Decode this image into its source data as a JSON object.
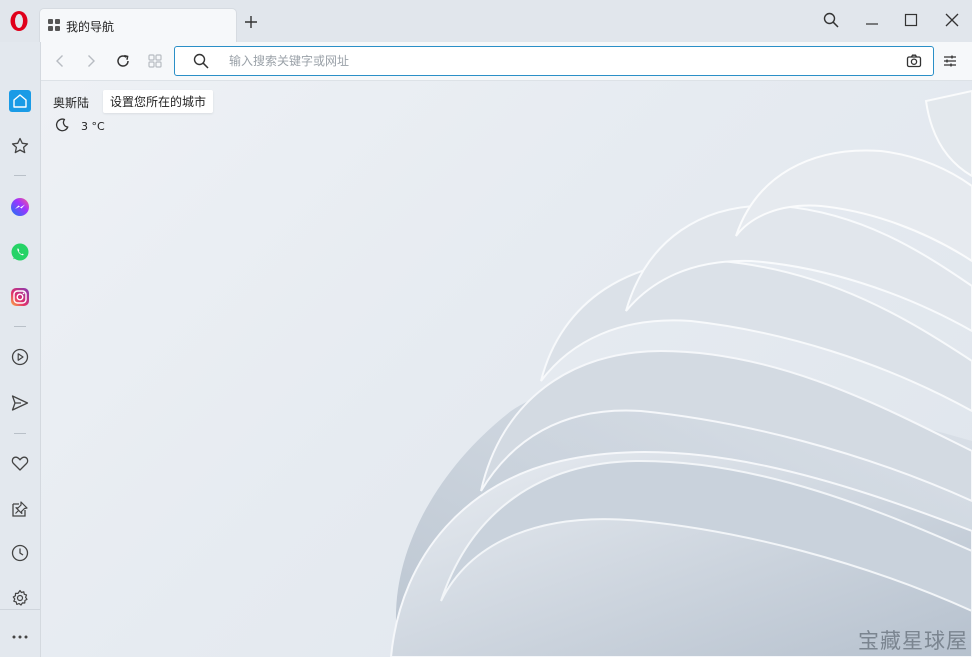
{
  "tab": {
    "title": "我的导航",
    "icon": "speed-dial-grid-icon"
  },
  "toolbar": {
    "search_placeholder": "输入搜索关键字或网址",
    "icons": [
      "back-icon",
      "forward-icon",
      "reload-icon",
      "tab-overview-icon",
      "search-icon",
      "camera-icon",
      "easy-setup-icon"
    ]
  },
  "window": {
    "icons": [
      "search-tabs-icon",
      "minimize-icon",
      "maximize-icon",
      "close-icon"
    ]
  },
  "sidebar": {
    "items": [
      {
        "name": "home-icon",
        "active": true
      },
      {
        "name": "bookmarks-icon"
      },
      {
        "name": "messenger-icon"
      },
      {
        "name": "whatsapp-icon"
      },
      {
        "name": "instagram-icon"
      },
      {
        "name": "player-icon"
      },
      {
        "name": "send-icon"
      },
      {
        "name": "favorites-heart-icon"
      },
      {
        "name": "pinboard-icon"
      },
      {
        "name": "history-icon"
      },
      {
        "name": "settings-icon"
      },
      {
        "name": "more-icon"
      }
    ]
  },
  "weather": {
    "city": "奥斯陆",
    "tooltip": "设置您所在的城市",
    "temperature": "3 °C"
  },
  "watermark": "宝藏星球屋",
  "colors": {
    "accent": "#1a9be6",
    "opera_red": "#e0001b",
    "address_border": "#2a8fc7"
  }
}
